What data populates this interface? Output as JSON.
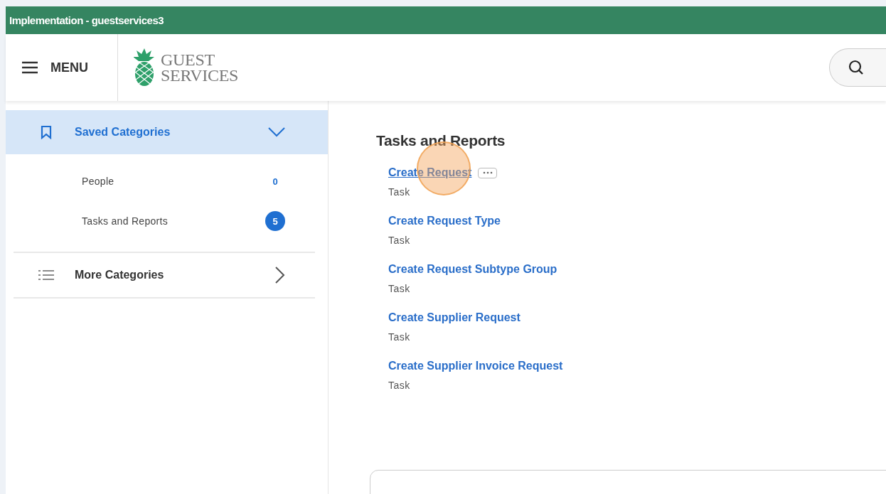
{
  "window": {
    "title": "Implementation - guestservices3"
  },
  "header": {
    "menu_label": "MENU",
    "logo": {
      "line1": "GUEST",
      "line2": "SERVICES"
    }
  },
  "sidebar": {
    "sections": [
      {
        "label": "Saved Categories",
        "kind": "bookmark",
        "selected": true,
        "expanded": true,
        "items": [
          {
            "label": "People",
            "count": "0",
            "highlighted": false
          },
          {
            "label": "Tasks and Reports",
            "count": "5",
            "highlighted": true
          }
        ]
      },
      {
        "label": "More Categories",
        "kind": "list",
        "selected": false,
        "expanded": false
      }
    ]
  },
  "main": {
    "heading": "Tasks and Reports",
    "results": [
      {
        "title": "Create Request",
        "type": "Task",
        "focused": true
      },
      {
        "title": "Create Request Type",
        "type": "Task",
        "focused": false
      },
      {
        "title": "Create Request Subtype Group",
        "type": "Task",
        "focused": false
      },
      {
        "title": "Create Supplier Request",
        "type": "Task",
        "focused": false
      },
      {
        "title": "Create Supplier Invoice Request",
        "type": "Task",
        "focused": false
      }
    ]
  }
}
